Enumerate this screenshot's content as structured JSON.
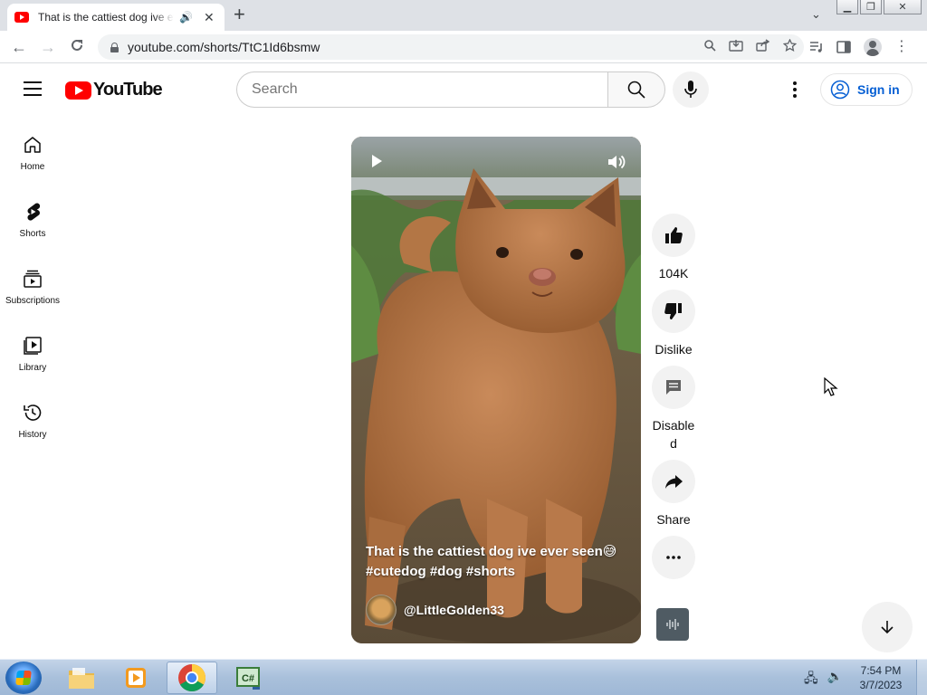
{
  "browser": {
    "tab": {
      "title": "That is the cattiest dog ive ever seen #cutedog #dog #shorts - YouTube",
      "audio_icon": "speaker-icon",
      "close": "✕"
    },
    "new_tab": "+",
    "window_controls": {
      "minimize": "▁",
      "restore": "❐",
      "close": "✕"
    },
    "url": "youtube.com/shorts/TtC1Id6bsmw"
  },
  "youtube": {
    "logo_text": "YouTube",
    "search_placeholder": "Search",
    "signin_label": "Sign in",
    "guide": [
      {
        "label": "Home",
        "icon": "home-icon"
      },
      {
        "label": "Shorts",
        "icon": "shorts-icon"
      },
      {
        "label": "Subscriptions",
        "icon": "subscriptions-icon"
      },
      {
        "label": "Library",
        "icon": "library-icon"
      },
      {
        "label": "History",
        "icon": "history-icon"
      }
    ],
    "short": {
      "caption_line1": "That is the cattiest dog ive ever seen😅",
      "caption_line2": "#cutedog #dog #shorts",
      "channel": "@LittleGolden33"
    },
    "actions": {
      "like": "104K",
      "dislike": "Dislike",
      "comments": "Disabled",
      "share": "Share"
    }
  },
  "taskbar": {
    "time": "7:54 PM",
    "date": "3/7/2023",
    "apps": [
      "file-explorer",
      "media-player",
      "chrome",
      "csharp-editor"
    ]
  },
  "colors": {
    "yt_red": "#ff0000",
    "signin_blue": "#065fd4",
    "chip_grey": "#f2f2f2"
  }
}
